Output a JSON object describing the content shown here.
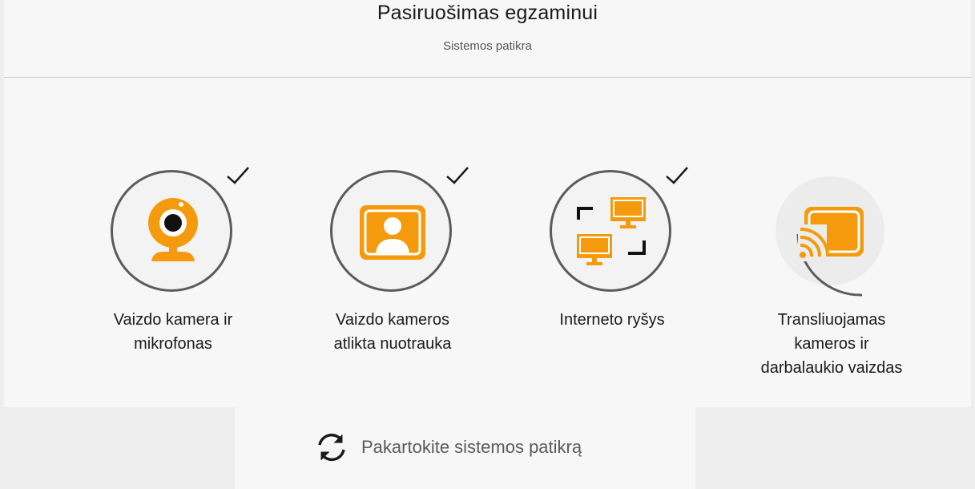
{
  "header": {
    "title": "Pasiruošimas egzaminui",
    "subtitle": "Sistemos patikra"
  },
  "steps": [
    {
      "label_line1": "Vaizdo kamera ir",
      "label_line2": "mikrofonas",
      "label_line3": "",
      "status": "complete",
      "icon": "webcam-icon"
    },
    {
      "label_line1": "Vaizdo kameros",
      "label_line2": "atlikta nuotrauka",
      "label_line3": "",
      "status": "complete",
      "icon": "photo-portrait-icon"
    },
    {
      "label_line1": "Interneto ryšys",
      "label_line2": "",
      "label_line3": "",
      "status": "complete",
      "icon": "network-monitors-icon"
    },
    {
      "label_line1": "Transliuojamas",
      "label_line2": "kameros ir",
      "label_line3": "darbalaukio vaizdas",
      "status": "in-progress",
      "icon": "cast-icon"
    }
  ],
  "retry": {
    "label": "Pakartokite sistemos patikrą",
    "icon": "refresh-icon"
  },
  "colors": {
    "accent": "#f59a0c",
    "ring": "#5b5b5b",
    "check": "#1a1a1a"
  }
}
